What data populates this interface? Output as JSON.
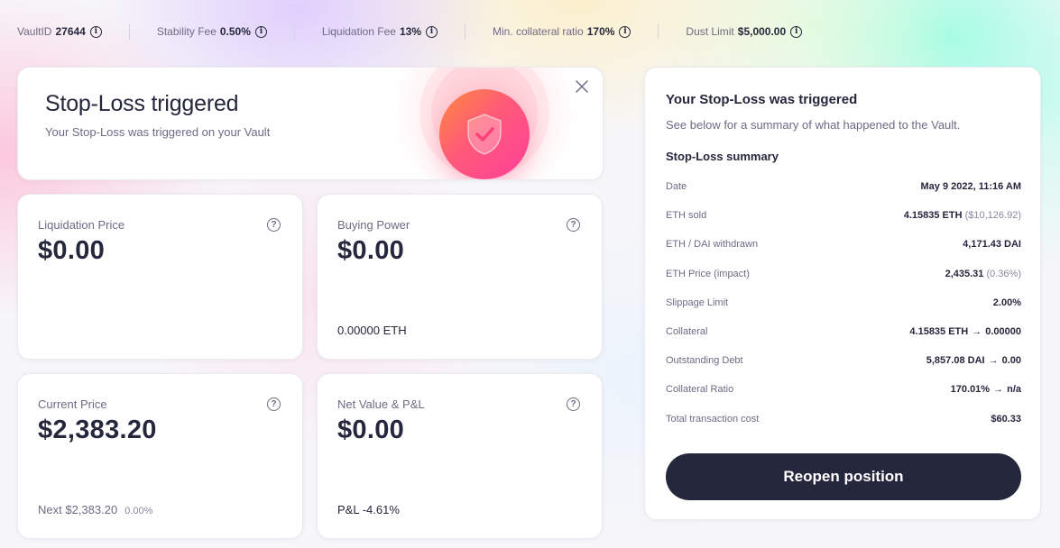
{
  "topbar": {
    "items": [
      {
        "label": "VaultID",
        "value": "27644"
      },
      {
        "label": "Stability Fee",
        "value": "0.50%"
      },
      {
        "label": "Liquidation Fee",
        "value": "13%"
      },
      {
        "label": "Min. collateral ratio",
        "value": "170%"
      },
      {
        "label": "Dust Limit",
        "value": "$5,000.00"
      }
    ]
  },
  "banner": {
    "title": "Stop-Loss triggered",
    "subtitle": "Your Stop-Loss was triggered on your Vault"
  },
  "stats": {
    "liquidation": {
      "label": "Liquidation Price",
      "value": "$0.00"
    },
    "buying_power": {
      "label": "Buying Power",
      "value": "$0.00",
      "footer": "0.00000 ETH"
    },
    "current_price": {
      "label": "Current Price",
      "value": "$2,383.20",
      "next_label": "Next $2,383.20",
      "next_change": "0.00%"
    },
    "net_value": {
      "label": "Net Value & P&L",
      "value": "$0.00",
      "footer": "P&L -4.61%"
    }
  },
  "summary": {
    "title": "Your Stop-Loss was triggered",
    "description": "See below for a summary of what happened to the Vault.",
    "subtitle": "Stop-Loss summary",
    "rows": [
      {
        "key": "Date",
        "value": "May 9 2022, 11:16 AM"
      },
      {
        "key": "ETH sold",
        "value": "4.15835 ETH",
        "sub": "($10,126.92)"
      },
      {
        "key": "ETH / DAI withdrawn",
        "value": "4,171.43 DAI"
      },
      {
        "key": "ETH Price (impact)",
        "value": "2,435.31",
        "sub": "(0.36%)"
      },
      {
        "key": "Slippage Limit",
        "value": "2.00%"
      },
      {
        "key": "Collateral",
        "from": "4.15835 ETH",
        "arrow": "→",
        "to": "0.00000"
      },
      {
        "key": "Outstanding Debt",
        "from": "5,857.08 DAI",
        "arrow": "→",
        "to": "0.00"
      },
      {
        "key": "Collateral Ratio",
        "from": "170.01%",
        "arrow": "→",
        "to": "n/a"
      },
      {
        "key": "Total transaction cost",
        "value": "$60.33"
      }
    ],
    "button_label": "Reopen position"
  },
  "icons": {
    "info": "info-icon",
    "help": "question-icon",
    "close": "close-icon",
    "shield": "shield-check-icon"
  },
  "colors": {
    "primary": "#25273d",
    "muted": "#6e6a85",
    "badge_gradient_start": "#ff8a3d",
    "badge_gradient_end": "#ff3f9b"
  }
}
